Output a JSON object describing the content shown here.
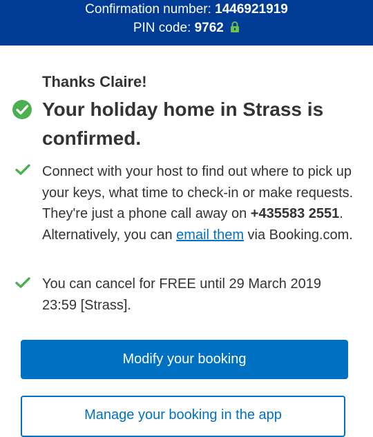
{
  "header": {
    "confirmation_label": "Confirmation number:",
    "confirmation_number": "1446921919",
    "pin_label": "PIN code:",
    "pin_code": "9762",
    "lock_icon": "lock-icon",
    "background_color": "#003b95",
    "lock_color": "#6cc24a"
  },
  "main": {
    "thanks": "Thanks Claire!",
    "confirm_icon": "check-circle-icon",
    "confirm_title": "Your holiday home in Strass is confirmed.",
    "host_bullet": {
      "text_before_phone": "Connect with your host to find out where to pick up your keys, what time to check-in or make requests. They're just a phone call away on ",
      "phone": "+435583 2551",
      "text_after_phone": ". Alternatively, you can ",
      "link": "email them",
      "text_end": " via Booking.com."
    },
    "cancel_bullet": {
      "text": "You can cancel for FREE until 29 March 2019 23:59 [Strass]."
    },
    "check_icon": "checkmark-icon",
    "check_color": "#4caf50"
  },
  "actions": {
    "modify_label": "Modify your booking",
    "manage_label": "Manage your booking in the app",
    "primary_color": "#0071c2"
  }
}
